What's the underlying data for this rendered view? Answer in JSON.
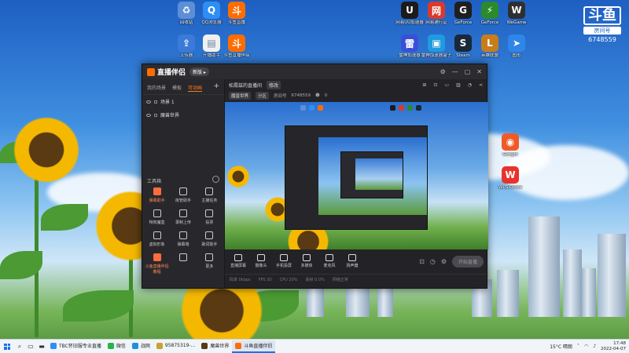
{
  "desktop": {
    "icons": [
      {
        "label": "回收站",
        "icon": "recycle-bin-icon",
        "color": "#5d8fd6",
        "glyph": "♻"
      },
      {
        "label": "QQ浏览器",
        "icon": "qq-browser-icon",
        "color": "#2f8ef4",
        "glyph": "Q"
      },
      {
        "label": "斗鱼直播",
        "icon": "douyu-icon",
        "color": "#ff6d00",
        "glyph": "斗"
      },
      {
        "label": "上传器",
        "icon": "uploader-icon",
        "color": "#3b7ad8",
        "glyph": "⇪"
      },
      {
        "label": "开播助手",
        "icon": "document-icon",
        "color": "#f1f1f1",
        "glyph": "▤"
      },
      {
        "label": "斗鱼直播伴侣",
        "icon": "douyu-companion-icon",
        "color": "#ff6d00",
        "glyph": "斗"
      },
      {
        "label": "网易UU加速器",
        "icon": "uu-accelerator-icon",
        "color": "#1b1b1b",
        "glyph": "U"
      },
      {
        "label": "网易通行证",
        "icon": "netease-icon",
        "color": "#d93a2b",
        "glyph": "网"
      },
      {
        "label": "GeForce",
        "icon": "geforce-icon",
        "color": "#1f1f1f",
        "glyph": "G"
      },
      {
        "label": "GeForce",
        "icon": "geforce-icon",
        "color": "#2b8a2b",
        "glyph": "⚡"
      },
      {
        "label": "WeGame",
        "icon": "wegame-icon",
        "color": "#2f2f2f",
        "glyph": "W"
      },
      {
        "label": "雷神加速器",
        "icon": "accelerator-icon",
        "color": "#3a4fd8",
        "glyph": "雷"
      },
      {
        "label": "雷神加速器盒子",
        "icon": "game-box-icon",
        "color": "#1e9be0",
        "glyph": "▣"
      },
      {
        "label": "Steam",
        "icon": "steam-icon",
        "color": "#1b2838",
        "glyph": "S"
      },
      {
        "label": "英雄联盟",
        "icon": "lol-icon",
        "color": "#c77d1a",
        "glyph": "L"
      },
      {
        "label": "图形",
        "icon": "app-icon",
        "color": "#2e86e8",
        "glyph": "➤"
      },
      {
        "label": "Google",
        "icon": "map-icon",
        "color": "#f05a28",
        "glyph": "◉"
      },
      {
        "label": "WPS Office",
        "icon": "wps-icon",
        "color": "#e8322c",
        "glyph": "W"
      }
    ],
    "watermark": {
      "logo": "斗鱼",
      "room_label": "房间号",
      "room_number": "6748559"
    }
  },
  "app": {
    "title": "直播伴侣",
    "version": "新版 ▸",
    "window_controls": [
      "⚙",
      "—",
      "▢",
      "✕"
    ],
    "scene_tabs": [
      "我的场景",
      "模板",
      "可动画"
    ],
    "scenes": [
      "场景 1",
      "魔兽世界"
    ],
    "tools_title": "工具箱",
    "tools": [
      {
        "label": "弹幕助手",
        "hot": true
      },
      {
        "label": "房管助手",
        "hot": false
      },
      {
        "label": "主播任务",
        "hot": false
      },
      {
        "label": "特效魔盒",
        "hot": false
      },
      {
        "label": "录制上传",
        "hot": false
      },
      {
        "label": "投票",
        "hot": false
      },
      {
        "label": "虚拟形象",
        "hot": false
      },
      {
        "label": "弹幕墙",
        "hot": false
      },
      {
        "label": "歌词助手",
        "hot": false
      },
      {
        "label": "斗鱼直播伴侣教程",
        "hot": true
      },
      {
        "label": "",
        "hot": false
      },
      {
        "label": "更多",
        "hot": false
      }
    ],
    "room": {
      "title": "松霞兹的直播间",
      "edit": "修改",
      "category": "魔兽世界",
      "mode": "分区",
      "room_label": "房间号",
      "room_id": "6748559",
      "viewers": "0"
    },
    "controls": [
      {
        "label": "直播屏幕",
        "icon": "screen-icon"
      },
      {
        "label": "摄像头",
        "icon": "camera-icon"
      },
      {
        "label": "手机投屏",
        "icon": "phone-icon"
      },
      {
        "label": "多媒体",
        "icon": "media-icon"
      },
      {
        "label": "麦克风",
        "icon": "microphone-icon"
      },
      {
        "label": "扬声器",
        "icon": "speaker-icon"
      }
    ],
    "start_button": "开始直播",
    "status": [
      "码率 0kbps",
      "FPS 30",
      "CPU 20%",
      "丢帧 0.0%",
      "网络正常"
    ]
  },
  "taskbar": {
    "tasks": [
      {
        "label": "TBC怀旧服专业直播",
        "color": "#2f8ef4",
        "active": false
      },
      {
        "label": "微信",
        "color": "#2bb24c",
        "active": false
      },
      {
        "label": "战网",
        "color": "#1f8fe0",
        "active": false
      },
      {
        "label": "95875319-...",
        "color": "#c9a22f",
        "active": false
      },
      {
        "label": "魔兽世界",
        "color": "#5a3a12",
        "active": false
      },
      {
        "label": "斗鱼直播伴侣",
        "color": "#ff6d00",
        "active": true
      }
    ],
    "weather": "15°C 晴朗",
    "time": "17:48",
    "date": "2022-04-07"
  }
}
